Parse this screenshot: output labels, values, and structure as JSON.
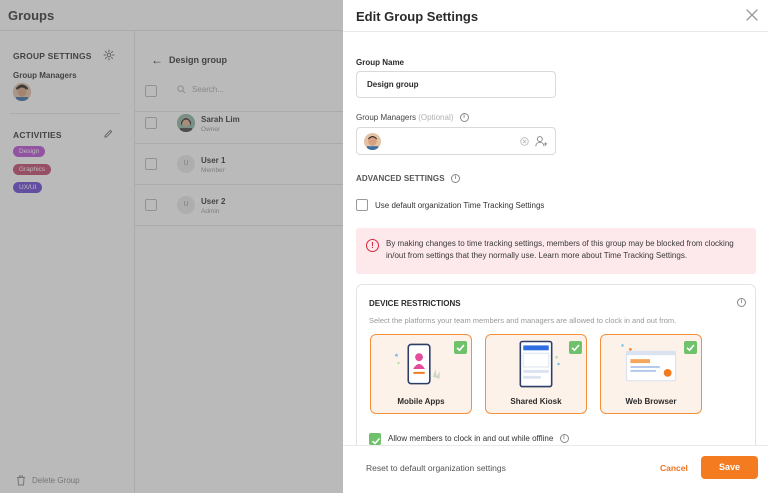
{
  "background": {
    "app_title": "Groups",
    "sidebar": {
      "group_settings_heading": "GROUP SETTINGS",
      "group_managers_label": "Group Managers",
      "activities_heading": "ACTIVITIES",
      "activities": [
        {
          "label": "Design",
          "color": "#b94fd6"
        },
        {
          "label": "Graphics",
          "color": "#c2476b"
        },
        {
          "label": "UX/UI",
          "color": "#6b46d6"
        }
      ],
      "delete_label": "Delete Group"
    },
    "main": {
      "back_label": "Design group",
      "search_placeholder": "Search...",
      "members": [
        {
          "name": "Sarah Lim",
          "role": "Owner",
          "initial": ""
        },
        {
          "name": "User 1",
          "role": "Member",
          "initial": "U"
        },
        {
          "name": "User 2",
          "role": "Admin",
          "initial": "U"
        }
      ]
    }
  },
  "drawer": {
    "title": "Edit Group Settings",
    "group_name_label": "Group Name",
    "group_name_value": "Design group",
    "group_managers_label": "Group Managers",
    "group_managers_optional": "(Optional)",
    "advanced_settings_title": "ADVANCED SETTINGS",
    "use_default_label": "Use default organization Time Tracking Settings",
    "use_default_checked": false,
    "warning_text": "By making changes to time tracking settings, members of this group may be blocked from clocking in/out from settings that they normally use. Learn more about Time Tracking Settings.",
    "device_restrictions": {
      "title": "DEVICE RESTRICTIONS",
      "description": "Select the platforms your team members and managers are allowed to clock in and out from.",
      "options": [
        {
          "label": "Mobile Apps",
          "checked": true
        },
        {
          "label": "Shared Kiosk",
          "checked": true
        },
        {
          "label": "Web Browser",
          "checked": true
        }
      ],
      "offline_label": "Allow members to clock in and out while offline",
      "offline_checked": true
    },
    "footer": {
      "reset_label": "Reset to default organization settings",
      "cancel_label": "Cancel",
      "save_label": "Save"
    }
  },
  "colors": {
    "accent": "#f47b20",
    "check_green": "#6fc26b",
    "warning_bg": "#fde8ec",
    "warning_icon": "#d7263d"
  }
}
